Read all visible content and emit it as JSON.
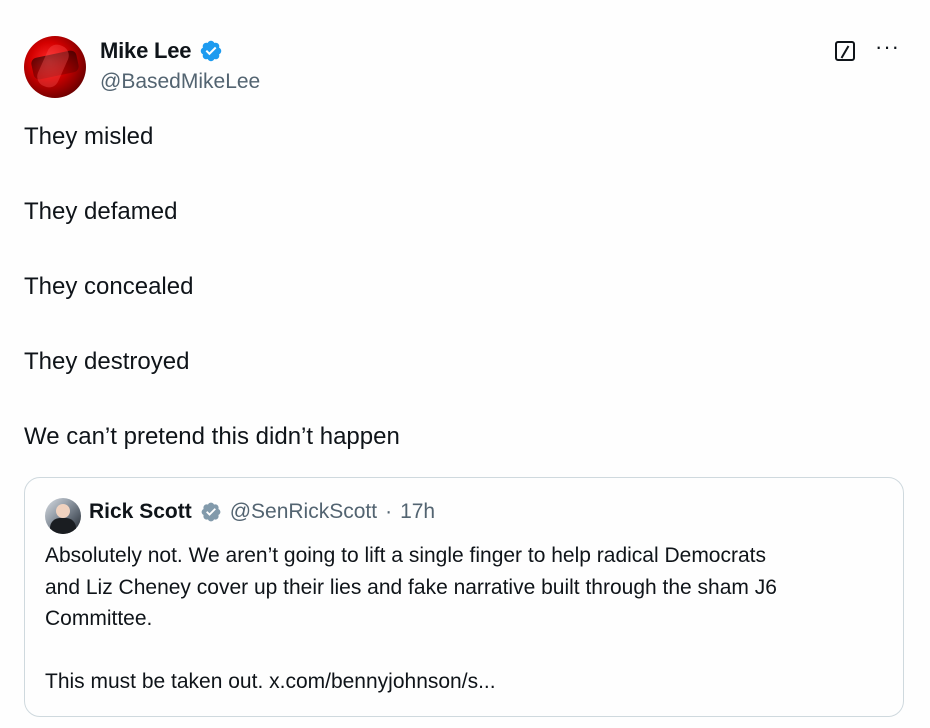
{
  "author": {
    "name": "Mike Lee",
    "handle": "@BasedMikeLee"
  },
  "tweet": {
    "lines": [
      "They misled",
      "They defamed",
      "They concealed",
      "They destroyed",
      "We can’t pretend this didn’t happen"
    ]
  },
  "quote": {
    "name": "Rick Scott",
    "handle": "@SenRickScott",
    "separator": "·",
    "time": "17h",
    "text_1": "Absolutely not. We aren’t going to lift a single finger to help radical Democrats",
    "text_2": "and Liz Cheney cover up their lies and fake narrative built through the sham J6",
    "text_3": "Committee.",
    "text_4": "This must be taken out. x.com/bennyjohnson/s..."
  },
  "colors": {
    "verified_blue": "#1d9bf0",
    "verified_gray": "#829aab",
    "text_secondary": "#536471",
    "border": "#cfd9de"
  },
  "icons": {
    "grok": "grok-icon",
    "more": "more-icon",
    "verified": "verified-badge-icon"
  }
}
